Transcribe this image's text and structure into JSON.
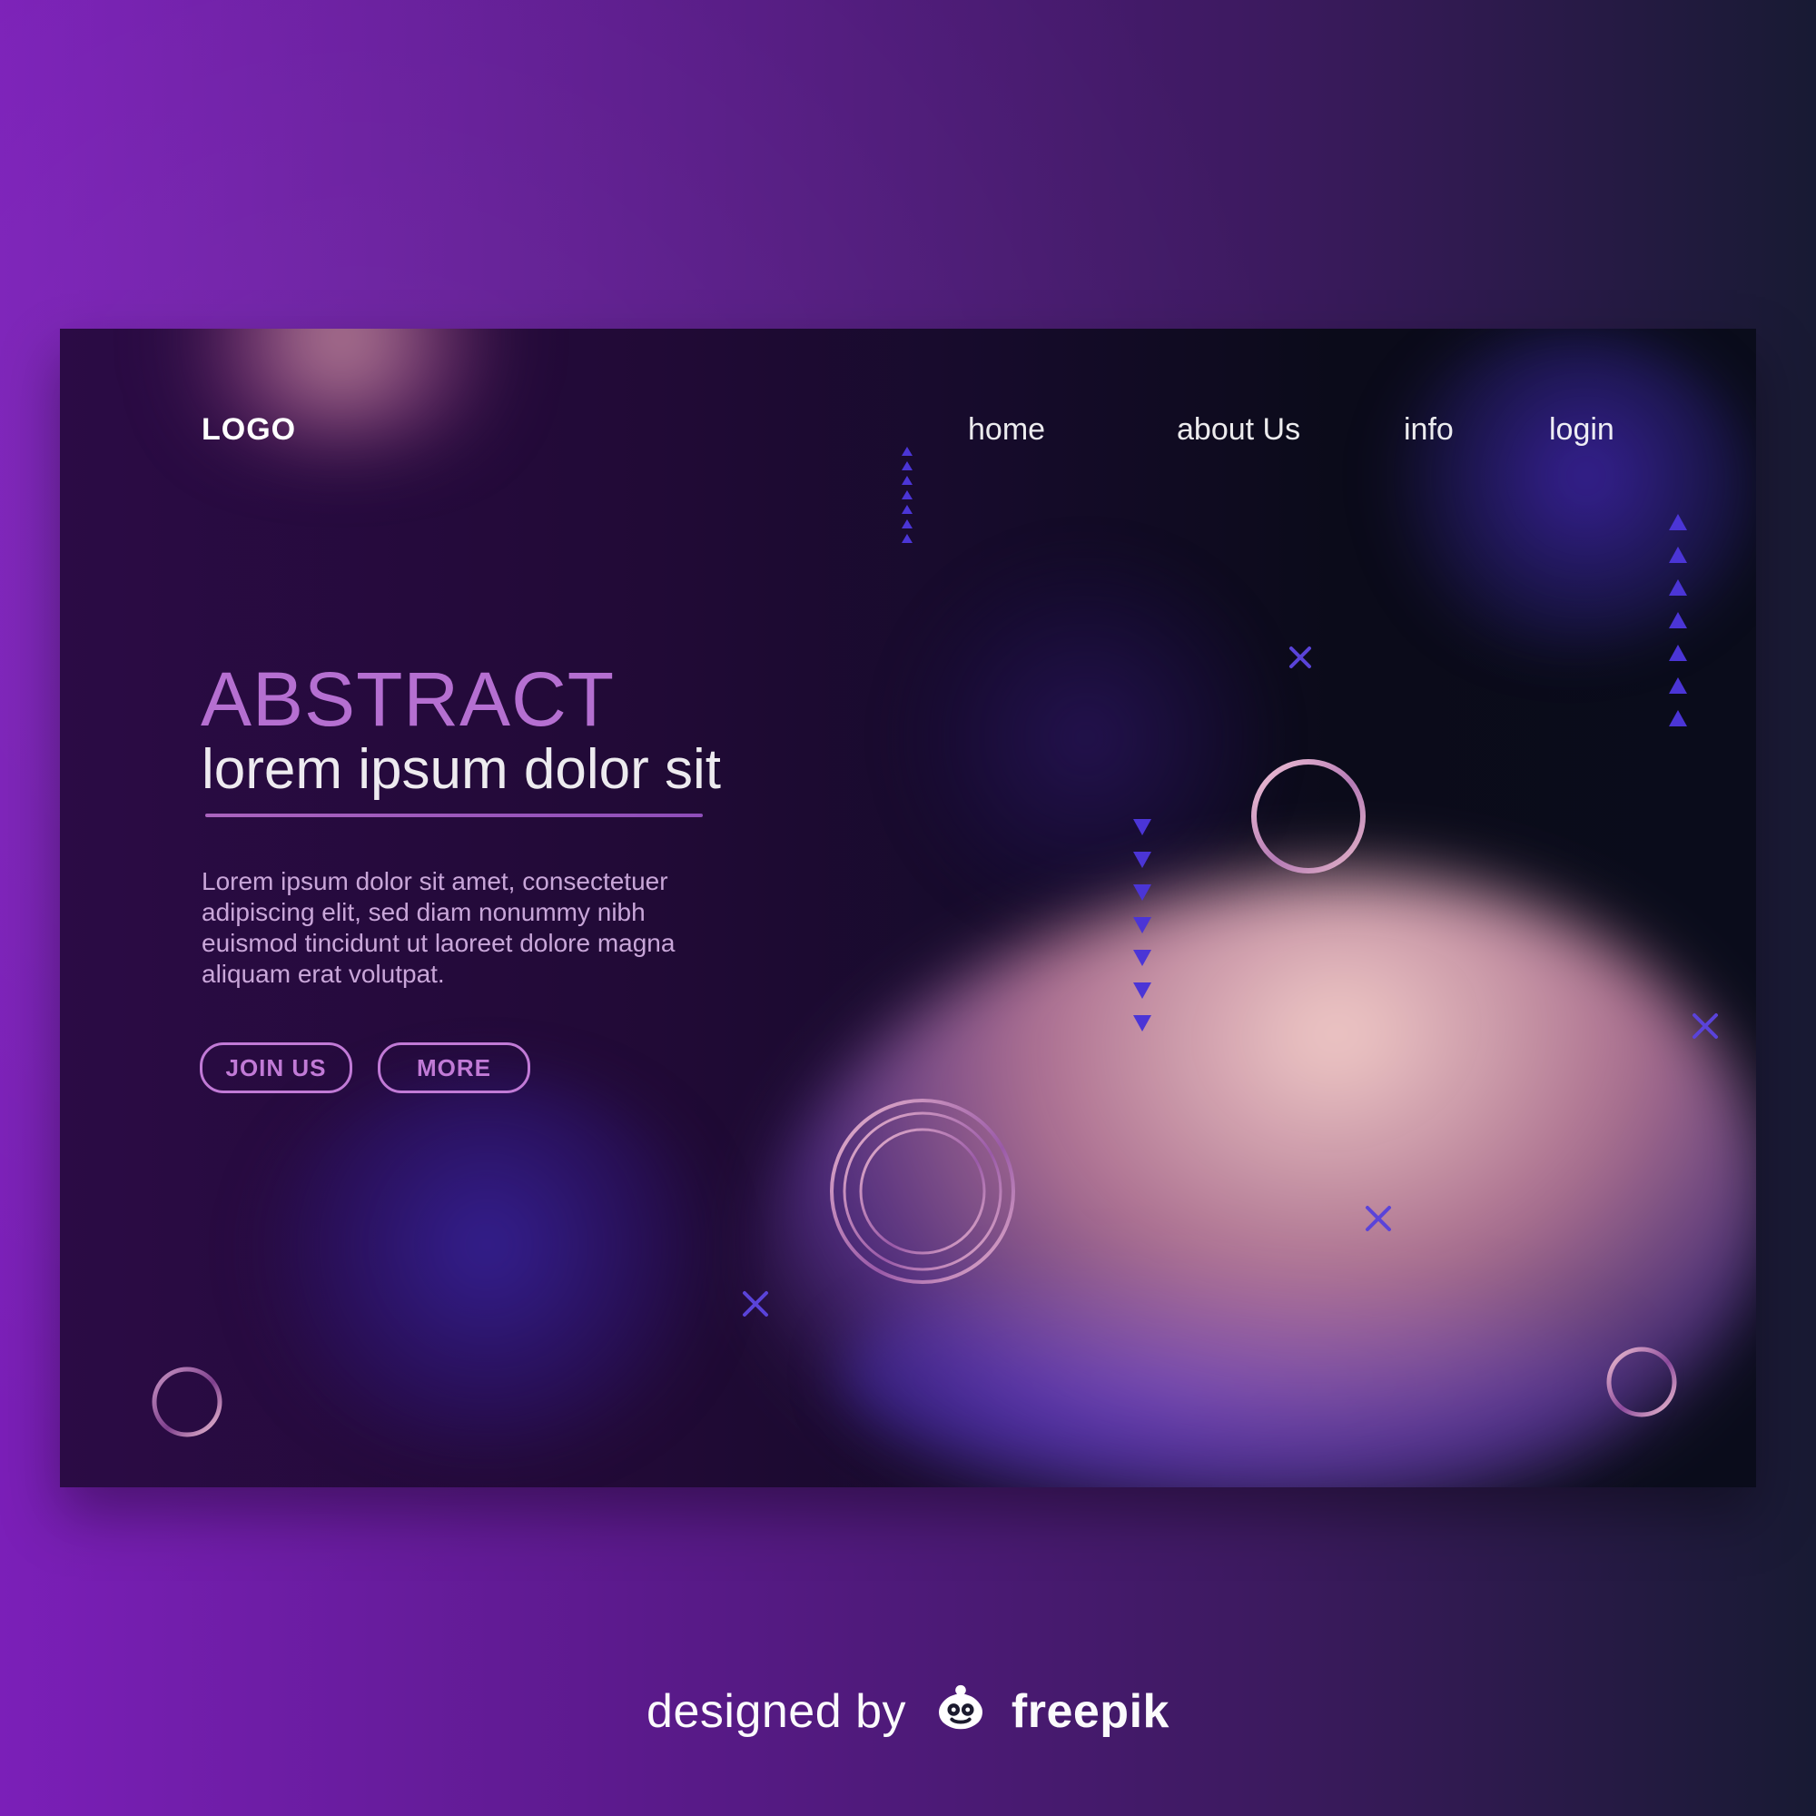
{
  "brand": {
    "logo_text": "LOGO"
  },
  "nav": {
    "items": [
      {
        "label": "home"
      },
      {
        "label": "about Us"
      },
      {
        "label": "info"
      },
      {
        "label": "login"
      }
    ]
  },
  "hero": {
    "title": "ABSTRACT",
    "subtitle": "lorem ipsum dolor sit",
    "description": "Lorem ipsum dolor sit amet, consectetuer adipiscing elit, sed diam nonummy nibh euismod tincidunt ut laoreet dolore magna aliquam erat volutpat."
  },
  "buttons": {
    "join_label": "JOIN US",
    "more_label": "MORE"
  },
  "credit": {
    "designed_by": "designed by",
    "brand": "freepik"
  },
  "colors": {
    "accent_purple": "#b56fd1",
    "button_border": "#c17ad6",
    "triangle": "#4b35d6",
    "x_mark": "#5a43d9",
    "ring_pink": "#e6b6c8"
  },
  "icons": {
    "credit_mark": "freepik-face-icon"
  }
}
